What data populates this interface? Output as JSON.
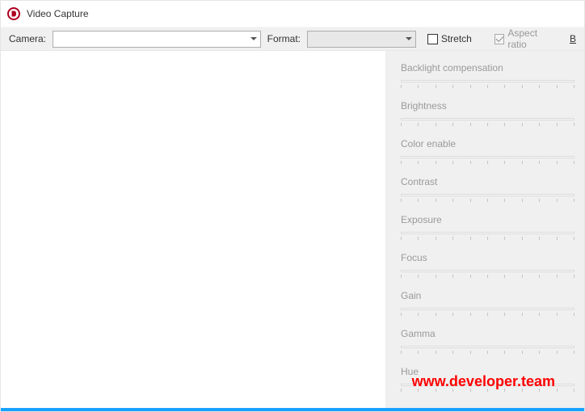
{
  "window": {
    "title": "Video Capture"
  },
  "toolbar": {
    "camera_label": "Camera:",
    "format_label": "Format:",
    "stretch_label": "Stretch",
    "aspect_label": "Aspect ratio",
    "right_letter": "B"
  },
  "params": [
    {
      "label": "Backlight compensation"
    },
    {
      "label": "Brightness"
    },
    {
      "label": "Color enable"
    },
    {
      "label": "Contrast"
    },
    {
      "label": "Exposure"
    },
    {
      "label": "Focus"
    },
    {
      "label": "Gain"
    },
    {
      "label": "Gamma"
    },
    {
      "label": "Hue"
    }
  ],
  "watermark": "www.developer.team"
}
